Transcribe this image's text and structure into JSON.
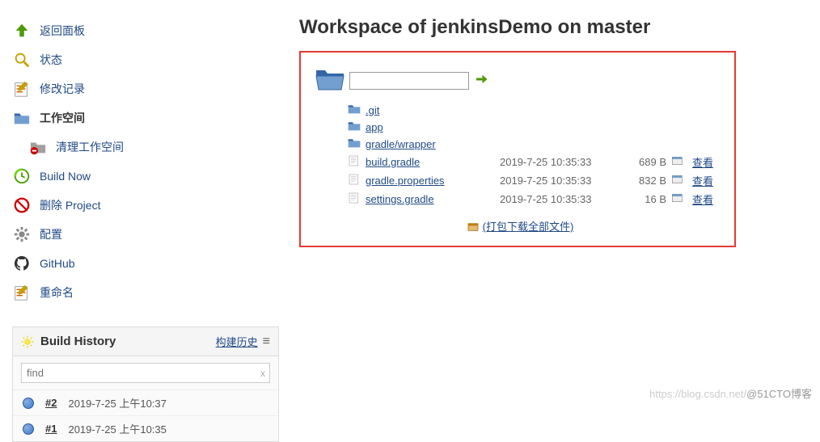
{
  "sidebar": {
    "items": [
      {
        "label": "返回面板"
      },
      {
        "label": "状态"
      },
      {
        "label": "修改记录"
      },
      {
        "label": "工作空间"
      },
      {
        "label": "清理工作空间"
      },
      {
        "label": "Build Now"
      },
      {
        "label": "删除 Project"
      },
      {
        "label": "配置"
      },
      {
        "label": "GitHub"
      },
      {
        "label": "重命名"
      }
    ]
  },
  "buildHistory": {
    "title": "Build History",
    "historyLink": "构建历史",
    "searchPlaceholder": "find",
    "rows": [
      {
        "num": "#2",
        "time": "2019-7-25 上午10:37"
      },
      {
        "num": "#1",
        "time": "2019-7-25 上午10:35"
      }
    ]
  },
  "main": {
    "title": "Workspace of jenkinsDemo on master",
    "folders": [
      {
        "name": ".git"
      },
      {
        "name": "app"
      },
      {
        "name": "gradle/wrapper"
      }
    ],
    "files": [
      {
        "name": "build.gradle",
        "date": "2019-7-25 10:35:33",
        "size": "689 B",
        "view": "查看"
      },
      {
        "name": "gradle.properties",
        "date": "2019-7-25 10:35:33",
        "size": "832 B",
        "view": "查看"
      },
      {
        "name": "settings.gradle",
        "date": "2019-7-25 10:35:33",
        "size": "16 B",
        "view": "查看"
      }
    ],
    "downloadAll": "(打包下载全部文件)"
  },
  "watermark": {
    "light": "https://blog.csdn.net/",
    "dark": "@51CTO博客"
  }
}
